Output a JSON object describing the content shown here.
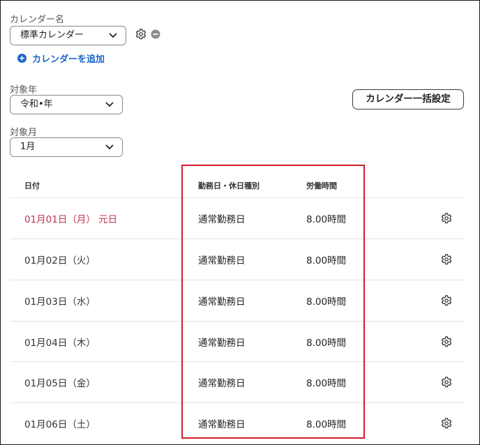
{
  "calendar": {
    "label": "カレンダー名",
    "selected": "標準カレンダー",
    "add_link": "カレンダーを追加"
  },
  "year": {
    "label": "対象年",
    "selected": "令和•年"
  },
  "month": {
    "label": "対象月",
    "selected": "1月"
  },
  "bulk_button": "カレンダー一括設定",
  "table": {
    "headers": {
      "date": "日付",
      "type": "勤務日・休日種別",
      "hours": "労働時間"
    },
    "rows": [
      {
        "date": "01月01日（月） 元日",
        "type": "通常勤務日",
        "hours": "8.00時間",
        "holiday": true
      },
      {
        "date": "01月02日（火）",
        "type": "通常勤務日",
        "hours": "8.00時間",
        "holiday": false
      },
      {
        "date": "01月03日（水）",
        "type": "通常勤務日",
        "hours": "8.00時間",
        "holiday": false
      },
      {
        "date": "01月04日（木）",
        "type": "通常勤務日",
        "hours": "8.00時間",
        "holiday": false
      },
      {
        "date": "01月05日（金）",
        "type": "通常勤務日",
        "hours": "8.00時間",
        "holiday": false
      },
      {
        "date": "01月06日（土）",
        "type": "通常勤務日",
        "hours": "8.00時間",
        "holiday": false
      }
    ]
  },
  "colors": {
    "accent": "#1a66c9",
    "holiday": "#c0354e",
    "highlight": "#d21d2a"
  }
}
